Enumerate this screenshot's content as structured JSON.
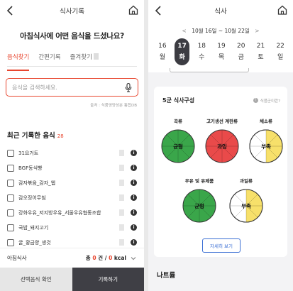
{
  "left": {
    "title": "식사기록",
    "question": "아침식사에 어떤 음식을 드셨나요?",
    "tabs": [
      {
        "label": "음식찾기",
        "active": true
      },
      {
        "label": "간편기록",
        "active": false
      },
      {
        "label": "즐겨찾기",
        "active": false
      }
    ],
    "search_placeholder": "음식을 검색하세요.",
    "source": "출처 : 식품영양성분 통합DB",
    "recent_title": "최근 기록한 음식",
    "recent_count": "28",
    "foods": [
      "31요거트",
      "BGF동식빵",
      "감자볶음_감자_웹",
      "감오징어무침",
      "강화우유_저지방우유_서울우유협동조합",
      "국밥_돼지고기",
      "굴_황금향_생것"
    ],
    "meal_label": "아침식사",
    "total_prefix": "총",
    "count_value": "0",
    "count_unit": "건",
    "divider": "/",
    "kcal_value": "0",
    "kcal_unit": "kcal",
    "btn_confirm": "선택음식 확인",
    "btn_record": "기록하기"
  },
  "right": {
    "title": "식사",
    "week_range": "10월 16일 ~ 10월 22일",
    "days": [
      {
        "d": "16",
        "w": "월",
        "selected": false
      },
      {
        "d": "17",
        "w": "화",
        "selected": true
      },
      {
        "d": "18",
        "w": "수",
        "selected": false
      },
      {
        "d": "19",
        "w": "목",
        "selected": false
      },
      {
        "d": "20",
        "w": "금",
        "selected": false
      },
      {
        "d": "21",
        "w": "토",
        "selected": false
      },
      {
        "d": "22",
        "w": "일",
        "selected": false
      }
    ],
    "card_title": "5군 식사구성",
    "card_hint": "식품군이란?",
    "groups": [
      {
        "label": "곡류",
        "status": "균형",
        "fill": 1.0,
        "color": "#3aa64a"
      },
      {
        "label": "고기생선 계란류",
        "status": "과잉",
        "fill": 1.0,
        "color": "#e94a4a"
      },
      {
        "label": "채소류",
        "status": "부족",
        "fill": 0.5,
        "color": "#f7e06a"
      },
      {
        "label": "우유 및 유제품",
        "status": "균형",
        "fill": 1.0,
        "color": "#3aa64a"
      },
      {
        "label": "과일류",
        "status": "부족",
        "fill": 0.5,
        "color": "#f7e06a"
      }
    ],
    "detail_btn": "자세히 보기",
    "next_section": "나트륨"
  }
}
